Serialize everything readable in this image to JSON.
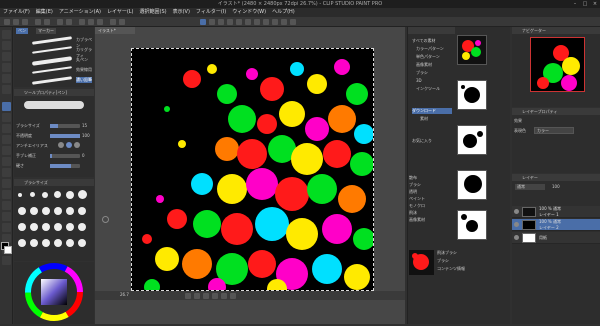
{
  "titlebar": {
    "title": "イラスト* (2480 × 2480px 72dpi 26.7%) - CLIP STUDIO PAINT PRO"
  },
  "menu": {
    "items": [
      "ファイル(F)",
      "編集(E)",
      "アニメーション(A)",
      "レイヤー(L)",
      "選択範囲(S)",
      "表示(V)",
      "フィルター(I)",
      "ウィンドウ(W)",
      "ヘルプ(H)"
    ]
  },
  "subtool": {
    "tabs": [
      "ペン",
      "マーカー"
    ],
    "brushes": [
      "カブラペン",
      "カリグラフィ",
      "丸ペン",
      "効果線用",
      "濃い鉛筆"
    ]
  },
  "toolprop": {
    "header": "ツールプロパティ[ペン]",
    "brush_size_label": "ブラシサイズ",
    "brush_size": "15",
    "opacity_label": "不透明度",
    "opacity": "100",
    "antialias_label": "アンチエイリアス",
    "stabilize_label": "手ブレ補正",
    "stabilize": "0",
    "hardness_label": "硬さ"
  },
  "brushsize": {
    "header": "ブラシサイズ"
  },
  "canvas": {
    "doc_tab": "イラスト*",
    "zoom": "26.7"
  },
  "material": {
    "tree": [
      "すべての素材",
      "カラーパターン",
      "単色パターン",
      "画像素材",
      "ブラシ",
      "3D",
      "インクツール",
      "ダウンロード",
      "素材",
      "お気に入り"
    ],
    "tags": [
      "散布",
      "ブラシ",
      "透明",
      "ペイント",
      "モノクロ",
      "飛沫",
      "画像素材"
    ],
    "thumbs_labels": [
      "ブラシ",
      "散布",
      "素材"
    ],
    "detail": {
      "name": "飛沫ブラシ",
      "type": "ブラシ",
      "info": "コンテンツ情報"
    }
  },
  "navigator": {
    "header": "ナビゲーター"
  },
  "layerprop": {
    "header": "レイヤープロパティ",
    "effect_label": "効果",
    "color_label": "表現色",
    "color_value": "カラー"
  },
  "layers": {
    "header": "レイヤー",
    "blend": "通常",
    "opacity": "100",
    "rows": [
      {
        "pct": "100 % 通常",
        "name": "レイヤー 1"
      },
      {
        "pct": "100 % 通常",
        "name": "レイヤー 2"
      },
      {
        "pct": "",
        "name": "用紙"
      }
    ]
  },
  "colors": {
    "accent": "#4a6ea8",
    "canvas_bg": "#000000"
  }
}
